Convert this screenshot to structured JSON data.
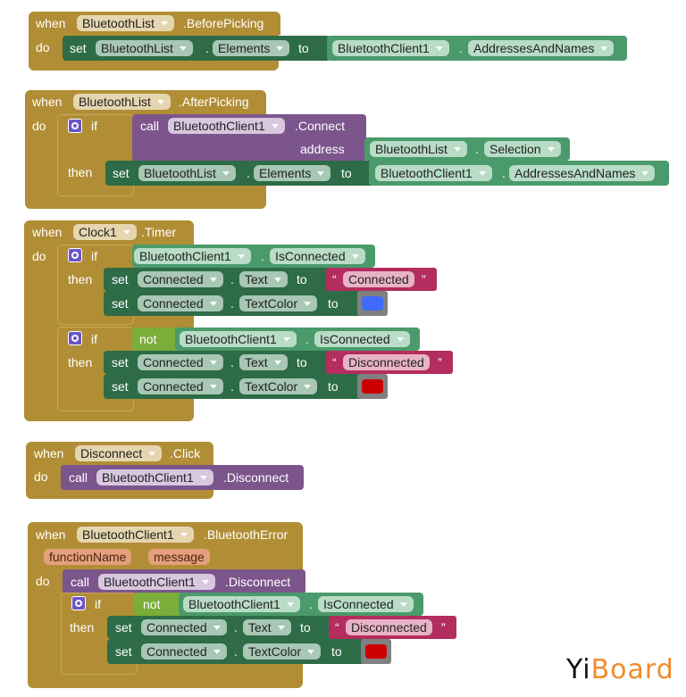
{
  "colors": {
    "event": "#b18e35",
    "set": "#2d6c47",
    "getter": "#4a9a6b",
    "call": "#7c558c",
    "logic_not": "#7aad3a",
    "text": "#b32d5e",
    "color_block": "#808080",
    "blue": "#3f6bff",
    "red": "#cc0000"
  },
  "blocks": [
    {
      "when": "when",
      "component": "BluetoothList",
      "event": ".BeforePicking",
      "do": "do",
      "set": {
        "kw": "set",
        "component": "BluetoothList",
        "property": "Elements",
        "to": "to",
        "value": {
          "component": "BluetoothClient1",
          "property": "AddressesAndNames"
        }
      }
    },
    {
      "when": "when",
      "component": "BluetoothList",
      "event": ".AfterPicking",
      "do": "do",
      "if": "if",
      "then": "then",
      "call": {
        "kw": "call",
        "component": "BluetoothClient1",
        "method": ".Connect",
        "arg": "address",
        "arg_value": {
          "component": "BluetoothList",
          "property": "Selection"
        }
      },
      "set": {
        "kw": "set",
        "component": "BluetoothList",
        "property": "Elements",
        "to": "to",
        "value": {
          "component": "BluetoothClient1",
          "property": "AddressesAndNames"
        }
      }
    },
    {
      "when": "when",
      "component": "Clock1",
      "event": ".Timer",
      "do": "do",
      "if1": {
        "if": "if",
        "then": "then",
        "cond": {
          "component": "BluetoothClient1",
          "property": "IsConnected"
        },
        "set_text": {
          "kw": "set",
          "component": "Connected",
          "property": "Text",
          "to": "to",
          "open_quote": "“",
          "value": "Connected",
          "close_quote": "”"
        },
        "set_color": {
          "kw": "set",
          "component": "Connected",
          "property": "TextColor",
          "to": "to",
          "color": "blue"
        }
      },
      "if2": {
        "if": "if",
        "then": "then",
        "not": "not",
        "cond": {
          "component": "BluetoothClient1",
          "property": "IsConnected"
        },
        "set_text": {
          "kw": "set",
          "component": "Connected",
          "property": "Text",
          "to": "to",
          "open_quote": "“",
          "value": "Disconnected",
          "close_quote": "”"
        },
        "set_color": {
          "kw": "set",
          "component": "Connected",
          "property": "TextColor",
          "to": "to",
          "color": "red"
        }
      }
    },
    {
      "when": "when",
      "component": "Disconnect",
      "event": ".Click",
      "do": "do",
      "call": {
        "kw": "call",
        "component": "BluetoothClient1",
        "method": ".Disconnect"
      }
    },
    {
      "when": "when",
      "component": "BluetoothClient1",
      "event": ".BluetoothError",
      "do": "do",
      "params": [
        "functionName",
        "message"
      ],
      "call": {
        "kw": "call",
        "component": "BluetoothClient1",
        "method": ".Disconnect"
      },
      "if": "if",
      "then": "then",
      "not": "not",
      "cond": {
        "component": "BluetoothClient1",
        "property": "IsConnected"
      },
      "set_text": {
        "kw": "set",
        "component": "Connected",
        "property": "Text",
        "to": "to",
        "open_quote": "“",
        "value": "Disconnected",
        "close_quote": "”"
      },
      "set_color": {
        "kw": "set",
        "component": "Connected",
        "property": "TextColor",
        "to": "to",
        "color": "red"
      }
    }
  ],
  "watermark": {
    "part1": "Yi",
    "part2": "Board"
  }
}
